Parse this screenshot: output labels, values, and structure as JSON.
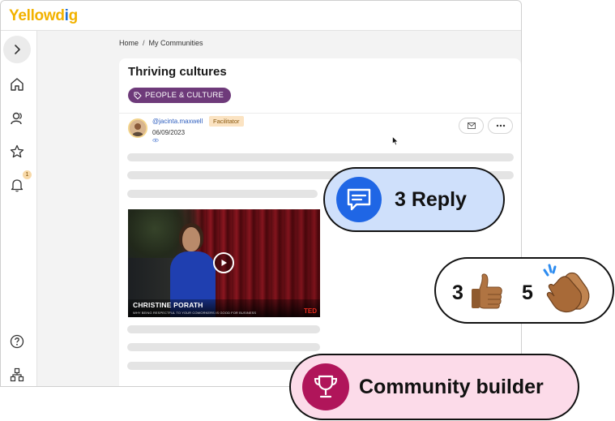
{
  "app": {
    "logo_part1": "Yellowd",
    "logo_part2": "i",
    "logo_part3": "g"
  },
  "sidebar": {
    "items": [
      {
        "icon": "chevron-right-icon"
      },
      {
        "icon": "home-icon"
      },
      {
        "icon": "people-icon"
      },
      {
        "icon": "star-icon"
      },
      {
        "icon": "bell-icon",
        "badge": "1"
      },
      {
        "icon": "help-icon"
      },
      {
        "icon": "sitemap-icon"
      }
    ]
  },
  "breadcrumb": {
    "home": "Home",
    "separator": "/",
    "current": "My Communities"
  },
  "post": {
    "title": "Thriving cultures",
    "tag": "PEOPLE & CULTURE",
    "author": "@jacinta.maxwell",
    "role": "Facilitator",
    "date": "06/09/2023",
    "video": {
      "speaker": "CHRISTINE PORATH",
      "talk": "WHY BEING RESPECTFUL TO YOUR COWORKERS IS GOOD FOR BUSINESS",
      "brand": "TED"
    }
  },
  "callouts": {
    "reply": "3 Reply",
    "thumbs_count": "3",
    "clap_count": "5",
    "builder": "Community builder"
  },
  "colors": {
    "accent_blue": "#1f66e5",
    "tag_purple": "#6e3a7a",
    "builder_magenta": "#b0155a",
    "reply_bg": "#cfe0fb",
    "builder_bg": "#fcdbe9"
  }
}
